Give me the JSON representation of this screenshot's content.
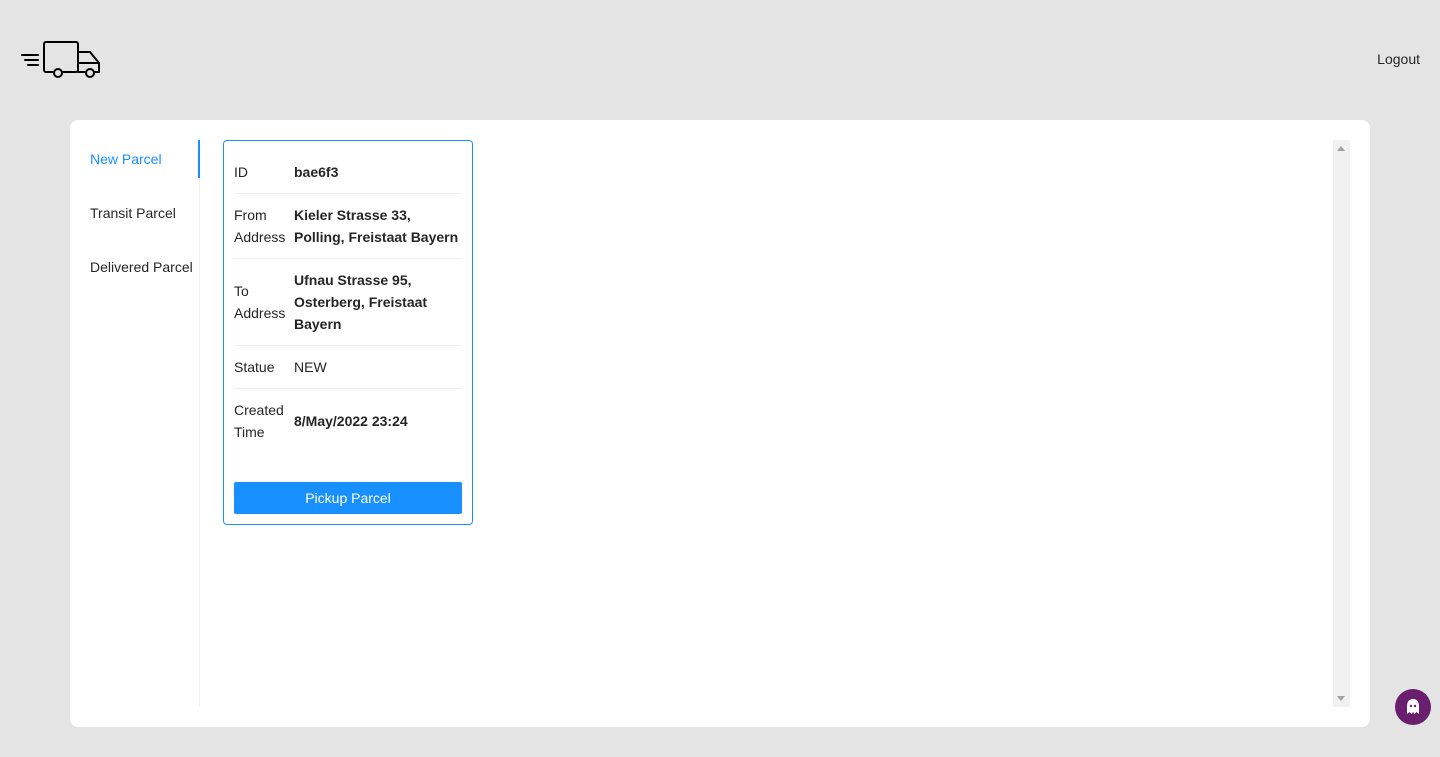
{
  "header": {
    "logo_icon": "delivery-truck-icon",
    "logout_label": "Logout"
  },
  "tabs": [
    {
      "label": "New Parcel",
      "active": true
    },
    {
      "label": "Transit Parcel",
      "active": false
    },
    {
      "label": "Delivered Parcel",
      "active": false
    }
  ],
  "parcel": {
    "id_label": "ID",
    "id_value": "bae6f3",
    "from_label": "From Address",
    "from_value": "Kieler Strasse 33, Polling, Freistaat Bayern",
    "to_label": "To Address",
    "to_value": "Ufnau Strasse 95, Osterberg, Freistaat Bayern",
    "status_label": "Statue",
    "status_value": "NEW",
    "created_label": "Created Time",
    "created_value": "8/May/2022 23:24",
    "action_label": "Pickup Parcel"
  },
  "colors": {
    "accent": "#1890ff",
    "background": "#e4e4e4",
    "help_button": "#6a1f6e"
  }
}
